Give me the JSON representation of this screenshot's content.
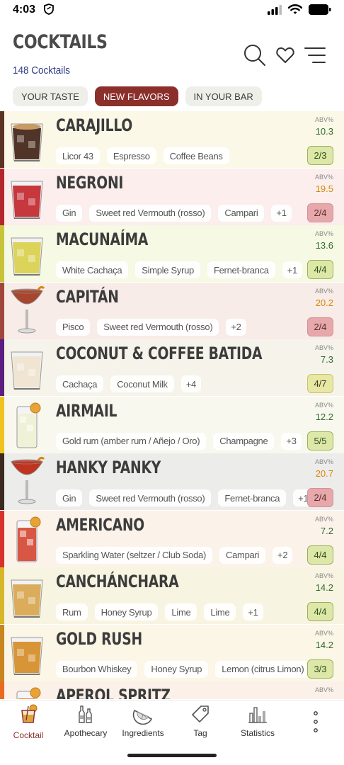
{
  "status": {
    "time": "4:03"
  },
  "header": {
    "title": "COCKTAILS",
    "count": "148 Cocktails"
  },
  "filters": [
    {
      "label": "YOUR TASTE",
      "active": false
    },
    {
      "label": "NEW FLAVORS",
      "active": true
    },
    {
      "label": "IN YOUR BAR",
      "active": false
    }
  ],
  "cocktails": [
    {
      "name": "CARAJILLO",
      "abv_label": "ABV%",
      "abv": "10.3",
      "abv_color": "#2e6b2a",
      "bg": "#fbf8e8",
      "stripe": "#5a3325",
      "ingredients": [
        "Licor 43",
        "Espresso",
        "Coffee Beans"
      ],
      "more": "",
      "match": "2/3",
      "match_state": "ok",
      "glass": "rocks",
      "liquid": "#3e1f12",
      "foam": "#c99a62"
    },
    {
      "name": "NEGRONI",
      "abv_label": "ABV%",
      "abv": "19.5",
      "abv_color": "#d9860a",
      "bg": "#fbeeed",
      "stripe": "#b3262b",
      "ingredients": [
        "Gin",
        "Sweet red Vermouth (rosso)",
        "Campari"
      ],
      "more": "+1",
      "match": "2/4",
      "match_state": "low",
      "glass": "rocks",
      "liquid": "#c2222a",
      "foam": ""
    },
    {
      "name": "MACUNAÍMA",
      "abv_label": "ABV%",
      "abv": "13.6",
      "abv_color": "#2e6b2a",
      "bg": "#f6f9e3",
      "stripe": "#c8c43a",
      "ingredients": [
        "White Cachaça",
        "Simple Syrup",
        "Fernet-branca"
      ],
      "more": "+1",
      "match": "4/4",
      "match_state": "ok",
      "glass": "rocks",
      "liquid": "#d9cf4a",
      "foam": ""
    },
    {
      "name": "CAPITÁN",
      "abv_label": "ABV%",
      "abv": "20.2",
      "abv_color": "#d9860a",
      "bg": "#f7ece7",
      "stripe": "#a0463a",
      "ingredients": [
        "Pisco",
        "Sweet red Vermouth (rosso)"
      ],
      "more": "+2",
      "match": "2/4",
      "match_state": "low",
      "glass": "coupe",
      "liquid": "#a8452d",
      "foam": ""
    },
    {
      "name": "COCONUT & COFFEE BATIDA",
      "abv_label": "ABV%",
      "abv": "7.3",
      "abv_color": "#2e6b2a",
      "bg": "#f6f3eb",
      "stripe": "#5a1e80",
      "ingredients": [
        "Cachaça",
        "Coconut Milk"
      ],
      "more": "+4",
      "match": "4/7",
      "match_state": "partial",
      "glass": "rocks",
      "liquid": "#efe3cf",
      "foam": ""
    },
    {
      "name": "AIRMAIL",
      "abv_label": "ABV%",
      "abv": "12.2",
      "abv_color": "#2e6b2a",
      "bg": "#f8f8ee",
      "stripe": "#f0c21d",
      "ingredients": [
        "Gold rum (amber rum / Añejo / Oro)",
        "Champagne"
      ],
      "more": "+3",
      "match": "5/5",
      "match_state": "ok",
      "glass": "highball",
      "liquid": "#eef1d2",
      "foam": ""
    },
    {
      "name": "HANKY PANKY",
      "abv_label": "ABV%",
      "abv": "20.7",
      "abv_color": "#d9860a",
      "bg": "#ececeb",
      "stripe": "#3a2a20",
      "ingredients": [
        "Gin",
        "Sweet red Vermouth (rosso)",
        "Fernet-branca"
      ],
      "more": "+1",
      "match": "2/4",
      "match_state": "low",
      "glass": "coupe",
      "liquid": "#c0331f",
      "foam": ""
    },
    {
      "name": "AMERICANO",
      "abv_label": "ABV%",
      "abv": "7.2",
      "abv_color": "#2e6b2a",
      "bg": "#fbf2ea",
      "stripe": "#d7322b",
      "ingredients": [
        "Sparkling Water (seltzer / Club Soda)",
        "Campari"
      ],
      "more": "+2",
      "match": "4/4",
      "match_state": "ok",
      "glass": "highball",
      "liquid": "#d23a25",
      "foam": ""
    },
    {
      "name": "CANCHÁNCHARA",
      "abv_label": "ABV%",
      "abv": "14.2",
      "abv_color": "#2e6b2a",
      "bg": "#f8f4e2",
      "stripe": "#d8b62a",
      "ingredients": [
        "Rum",
        "Honey Syrup",
        "Lime",
        "Lime"
      ],
      "more": "+1",
      "match": "4/4",
      "match_state": "ok",
      "glass": "rocks",
      "liquid": "#d7a44a",
      "foam": ""
    },
    {
      "name": "GOLD RUSH",
      "abv_label": "ABV%",
      "abv": "14.2",
      "abv_color": "#2e6b2a",
      "bg": "#fbf6e6",
      "stripe": "#c88520",
      "ingredients": [
        "Bourbon Whiskey",
        "Honey Syrup",
        "Lemon (citrus Limon)"
      ],
      "more": "",
      "match": "3/3",
      "match_state": "ok",
      "glass": "rocks",
      "liquid": "#d48b22",
      "foam": ""
    },
    {
      "name": "APEROL SPRITZ",
      "abv_label": "ABV%",
      "abv": "",
      "abv_color": "#2e6b2a",
      "bg": "#fbf1e8",
      "stripe": "#e86a1f",
      "ingredients": [],
      "more": "",
      "match": "",
      "match_state": "ok",
      "glass": "highball",
      "liquid": "#e86a1f",
      "foam": ""
    }
  ],
  "tabs": [
    {
      "label": "Cocktail",
      "icon": "cocktail-icon",
      "active": true
    },
    {
      "label": "Apothecary",
      "icon": "bottles-icon",
      "active": false
    },
    {
      "label": "Ingredients",
      "icon": "lime-slice-icon",
      "active": false
    },
    {
      "label": "Tag",
      "icon": "tag-icon",
      "active": false
    },
    {
      "label": "Statistics",
      "icon": "chart-icon",
      "active": false
    }
  ]
}
